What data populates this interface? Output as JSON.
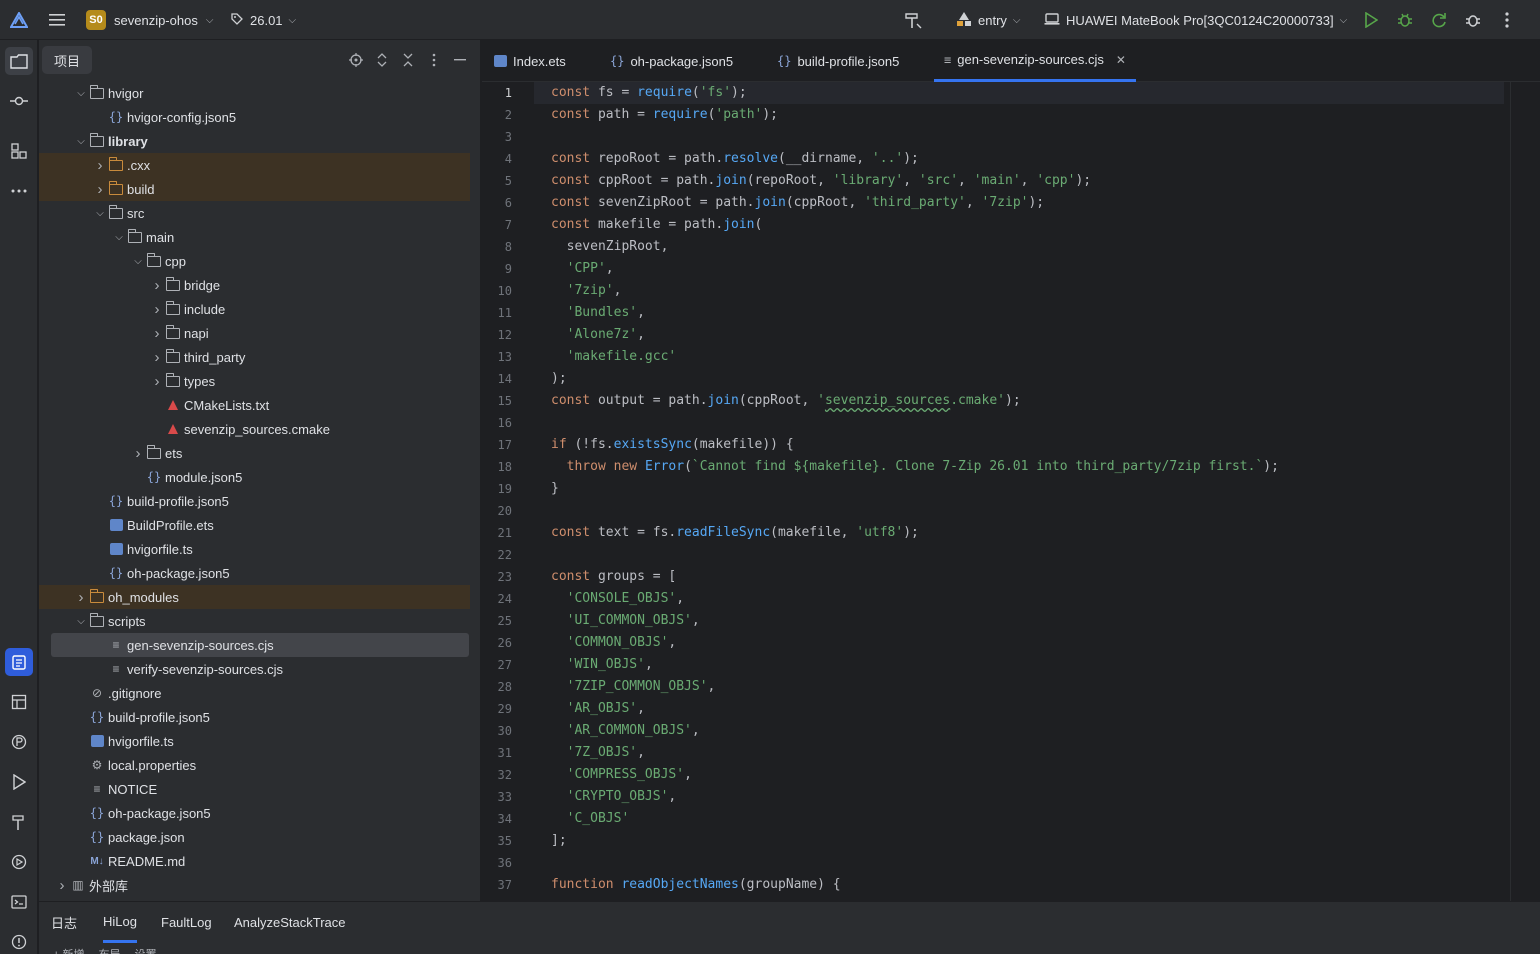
{
  "topbar": {
    "project_badge": "S0",
    "project_name": "sevenzip-ohos",
    "version": "26.01",
    "module": "entry",
    "device": "HUAWEI MateBook Pro[3QC0124C20000733]"
  },
  "project_panel": {
    "title": "项目"
  },
  "tree": [
    {
      "label": "hvigor",
      "type": "folder",
      "depth": 1,
      "expanded": true
    },
    {
      "label": "hvigor-config.json5",
      "type": "json",
      "depth": 2
    },
    {
      "label": "library",
      "type": "module",
      "depth": 1,
      "expanded": true,
      "bold": true
    },
    {
      "label": ".cxx",
      "type": "folder-excluded",
      "depth": 2,
      "expanded": false,
      "excluded": true
    },
    {
      "label": "build",
      "type": "folder-excluded",
      "depth": 2,
      "expanded": false,
      "excluded": true
    },
    {
      "label": "src",
      "type": "folder",
      "depth": 2,
      "expanded": true
    },
    {
      "label": "main",
      "type": "folder",
      "depth": 3,
      "expanded": true
    },
    {
      "label": "cpp",
      "type": "folder",
      "depth": 4,
      "expanded": true
    },
    {
      "label": "bridge",
      "type": "folder",
      "depth": 5,
      "expanded": false
    },
    {
      "label": "include",
      "type": "folder",
      "depth": 5,
      "expanded": false
    },
    {
      "label": "napi",
      "type": "folder",
      "depth": 5,
      "expanded": false
    },
    {
      "label": "third_party",
      "type": "folder",
      "depth": 5,
      "expanded": false
    },
    {
      "label": "types",
      "type": "folder",
      "depth": 5,
      "expanded": false
    },
    {
      "label": "CMakeLists.txt",
      "type": "cmake",
      "depth": 5
    },
    {
      "label": "sevenzip_sources.cmake",
      "type": "cmake",
      "depth": 5
    },
    {
      "label": "ets",
      "type": "folder",
      "depth": 4,
      "expanded": false
    },
    {
      "label": "module.json5",
      "type": "json",
      "depth": 4
    },
    {
      "label": "build-profile.json5",
      "type": "json",
      "depth": 2
    },
    {
      "label": "BuildProfile.ets",
      "type": "ets",
      "depth": 2
    },
    {
      "label": "hvigorfile.ts",
      "type": "ets",
      "depth": 2
    },
    {
      "label": "oh-package.json5",
      "type": "json",
      "depth": 2
    },
    {
      "label": "oh_modules",
      "type": "folder-excluded",
      "depth": 1,
      "expanded": false,
      "excluded": true
    },
    {
      "label": "scripts",
      "type": "folder",
      "depth": 1,
      "expanded": true
    },
    {
      "label": "gen-sevenzip-sources.cjs",
      "type": "text",
      "depth": 2,
      "selected": true
    },
    {
      "label": "verify-sevenzip-sources.cjs",
      "type": "text",
      "depth": 2
    },
    {
      "label": ".gitignore",
      "type": "ignore",
      "depth": 1
    },
    {
      "label": "build-profile.json5",
      "type": "json",
      "depth": 1
    },
    {
      "label": "hvigorfile.ts",
      "type": "ets",
      "depth": 1
    },
    {
      "label": "local.properties",
      "type": "gear",
      "depth": 1
    },
    {
      "label": "NOTICE",
      "type": "text",
      "depth": 1
    },
    {
      "label": "oh-package.json5",
      "type": "json",
      "depth": 1
    },
    {
      "label": "package.json",
      "type": "json",
      "depth": 1
    },
    {
      "label": "README.md",
      "type": "md",
      "depth": 1
    },
    {
      "label": "外部库",
      "type": "library",
      "depth": 0,
      "expanded": false
    }
  ],
  "editor_tabs": [
    {
      "label": "Index.ets",
      "icon": "ets"
    },
    {
      "label": "oh-package.json5",
      "icon": "json"
    },
    {
      "label": "build-profile.json5",
      "icon": "json"
    },
    {
      "label": "gen-sevenzip-sources.cjs",
      "icon": "text",
      "active": true
    }
  ],
  "code_lines": [
    "const fs = require('fs');",
    "const path = require('path');",
    "",
    "const repoRoot = path.resolve(__dirname, '..');",
    "const cppRoot = path.join(repoRoot, 'library', 'src', 'main', 'cpp');",
    "const sevenZipRoot = path.join(cppRoot, 'third_party', '7zip');",
    "const makefile = path.join(",
    "  sevenZipRoot,",
    "  'CPP',",
    "  '7zip',",
    "  'Bundles',",
    "  'Alone7z',",
    "  'makefile.gcc'",
    ");",
    "const output = path.join(cppRoot, 'sevenzip_sources.cmake');",
    "",
    "if (!fs.existsSync(makefile)) {",
    "  throw new Error(`Cannot find ${makefile}. Clone 7-Zip 26.01 into third_party/7zip first.`);",
    "}",
    "",
    "const text = fs.readFileSync(makefile, 'utf8');",
    "",
    "const groups = [",
    "  'CONSOLE_OBJS',",
    "  'UI_COMMON_OBJS',",
    "  'COMMON_OBJS',",
    "  'WIN_OBJS',",
    "  '7ZIP_COMMON_OBJS',",
    "  'AR_OBJS',",
    "  'AR_COMMON_OBJS',",
    "  '7Z_OBJS',",
    "  'COMPRESS_OBJS',",
    "  'CRYPTO_OBJS',",
    "  'C_OBJS'",
    "];",
    "",
    "function readObjectNames(groupName) {"
  ],
  "bottom_panel": {
    "tabs": [
      "日志",
      "HiLog",
      "FaultLog",
      "AnalyzeStackTrace"
    ],
    "active_tab": "HiLog",
    "toolbar": [
      "+ 新增",
      "布局",
      "设置"
    ]
  }
}
